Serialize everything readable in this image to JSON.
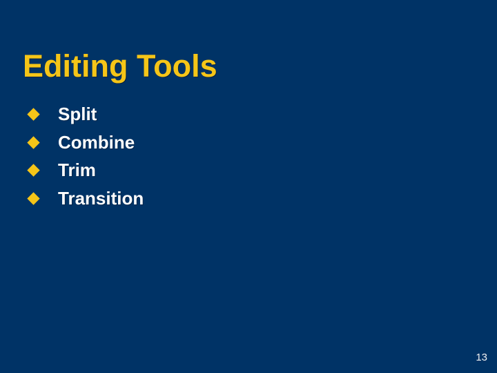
{
  "slide": {
    "background_color": "#003366",
    "title": "Editing Tools",
    "title_color": "#F5C518",
    "body_text_color": "#FFFFFF",
    "bullet_marker_color": "#F5C518",
    "bullet_marker_icon": "diamond-bullet-icon",
    "bullets": [
      {
        "label": "Split"
      },
      {
        "label": "Combine"
      },
      {
        "label": "Trim"
      },
      {
        "label": "Transition"
      }
    ],
    "page_number": "13"
  }
}
